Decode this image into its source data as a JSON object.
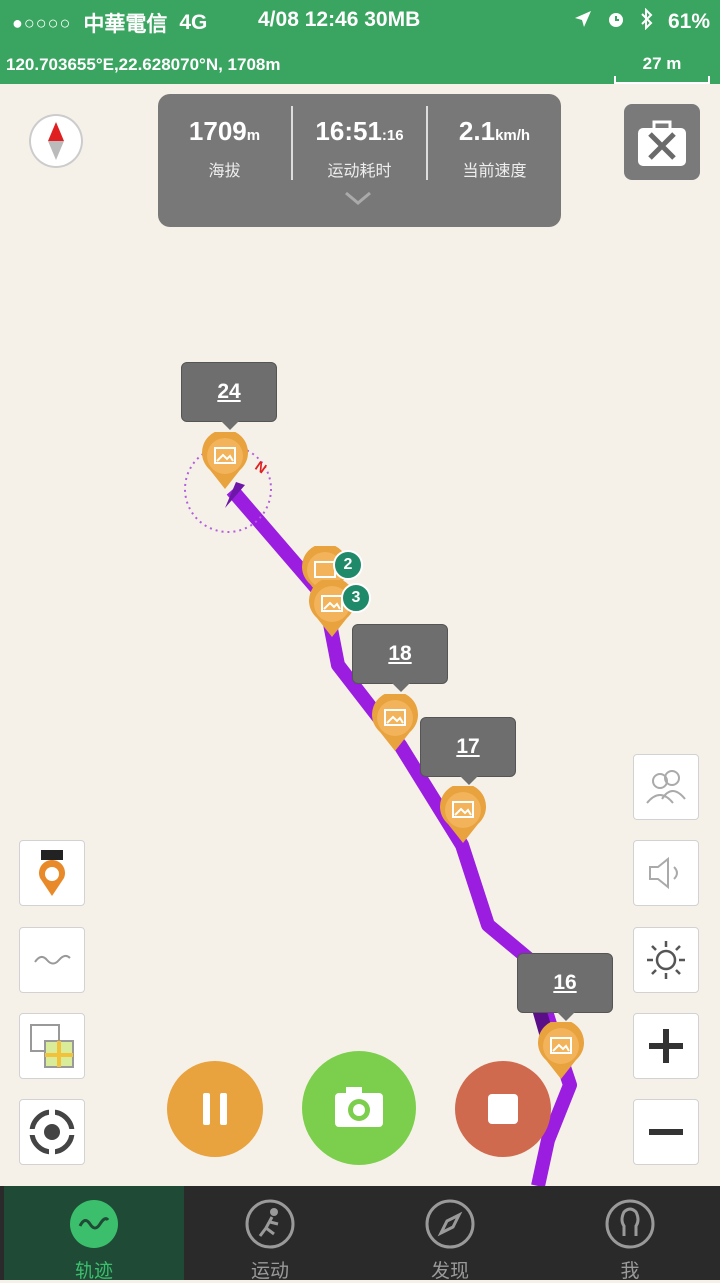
{
  "status_bar": {
    "signal": "●○○○○",
    "carrier": "中華電信",
    "network": "4G",
    "datetime_data": "4/08 12:46 30MB",
    "battery": "61%"
  },
  "coordinates_bar": {
    "coords": "120.703655°E,22.628070°N, 1708m",
    "scale_label": "27 m"
  },
  "stats": {
    "altitude_value": "1709",
    "altitude_unit": "m",
    "altitude_label": "海拔",
    "time_value": "16:51",
    "time_seconds": ":16",
    "time_label": "运动耗时",
    "speed_value": "2.1",
    "speed_unit": "km/h",
    "speed_label": "当前速度"
  },
  "map": {
    "labels": [
      "24",
      "18",
      "17",
      "16"
    ],
    "cluster_badges": [
      "2",
      "3"
    ],
    "north": "N",
    "track_color": "#9a1de0"
  },
  "tabs": [
    {
      "label": "轨迹",
      "icon": "track-icon",
      "active": true
    },
    {
      "label": "运动",
      "icon": "run-icon",
      "active": false
    },
    {
      "label": "发现",
      "icon": "compass-icon",
      "active": false
    },
    {
      "label": "我",
      "icon": "profile-icon",
      "active": false
    }
  ],
  "colors": {
    "header_green": "#3aa560",
    "pause": "#e8a23e",
    "camera": "#7ccf4d",
    "stop": "#cf6a4f",
    "pin": "#e8a23e"
  }
}
